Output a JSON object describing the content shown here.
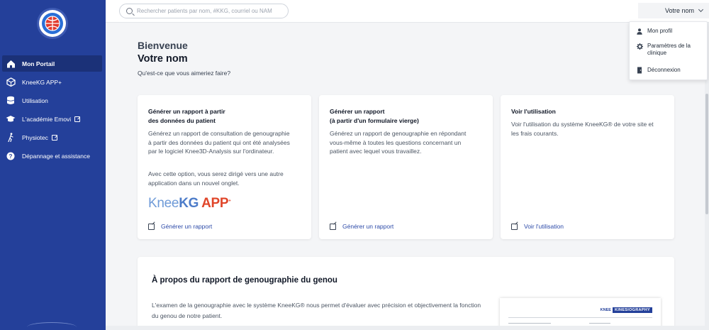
{
  "search": {
    "placeholder": "Rechercher patients par nom, #KKG, courriel ou NAM"
  },
  "user": {
    "name": "Votre nom"
  },
  "user_dropdown": {
    "items": [
      {
        "label": "Mon profil",
        "icon": "person-icon"
      },
      {
        "label": "Paramètres de la clinique",
        "icon": "gear-icon"
      },
      {
        "label": "Déconnexion",
        "icon": "door-icon"
      }
    ]
  },
  "sidebar": {
    "items": [
      {
        "label": "Mon Portail",
        "icon": "home-icon",
        "active": true,
        "external": false
      },
      {
        "label": "KneeKG APP+",
        "icon": "cube-icon",
        "active": false,
        "external": false
      },
      {
        "label": "Utilisation",
        "icon": "database-icon",
        "active": false,
        "external": false
      },
      {
        "label": "L'académie Emovi",
        "icon": "graduation-cap-icon",
        "active": false,
        "external": true
      },
      {
        "label": "Physiotec",
        "icon": "running-figure-icon",
        "active": false,
        "external": true
      },
      {
        "label": "Dépannage et assistance",
        "icon": "help-icon",
        "active": false,
        "external": false
      }
    ]
  },
  "main": {
    "welcome": "Bienvenue",
    "username": "Votre nom",
    "question": "Qu'est-ce que vous aimeriez faire?",
    "cards": [
      {
        "title_line1": "Générer un rapport à partir",
        "title_line2": "des données du patient",
        "description": "Générez un rapport de consultation de genougraphie à partir des données du patient qui ont été analysées par le logiciel Knee3D-Analysis sur l'ordinateur.",
        "description2": "Avec cette option, vous serez dirigé vers une autre application dans un nouvel onglet.",
        "logo": {
          "knee": "Knee",
          "kg": "KG",
          "app": "APP",
          "sup": "+"
        },
        "link": "Générer un rapport"
      },
      {
        "title_line1": "Générer un rapport",
        "title_line2": "(à partir d'un formulaire vierge)",
        "description": "Générez un rapport de genougraphie en répondant vous-même à toutes les questions concernant un patient avec lequel vous travaillez.",
        "link": "Générer un rapport"
      },
      {
        "title_line1": "Voir l'utilisation",
        "description": "Voir l'utilisation du système KneeKG® de votre site et les frais courants.",
        "link": "Voir l'utilisation"
      }
    ],
    "about": {
      "title": "À propos du rapport de genougraphie du genou",
      "description": "L'examen de la genougraphie avec le système KneeKG® nous permet d'évaluer avec précision et objectivement la fonction du genou de notre patient.",
      "thumbnail": {
        "brand_prefix": "KNEE",
        "brand_main": "KINESIOGRAPHY"
      }
    }
  },
  "colors": {
    "sidebar": "#24409a",
    "sidebar_active": "#1b3178",
    "link": "#2c4aa8",
    "brand_red": "#e0462a"
  }
}
